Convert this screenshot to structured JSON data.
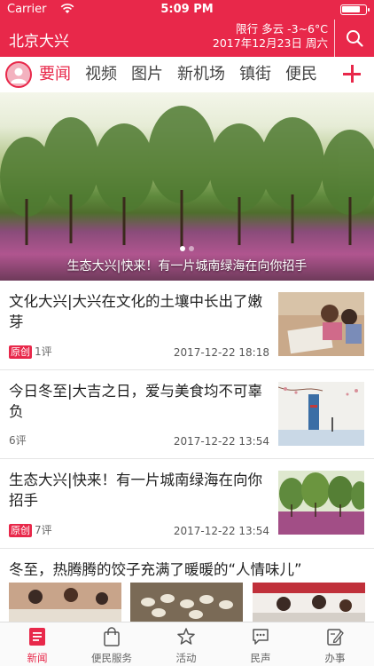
{
  "status_bar": {
    "carrier": "Carrier",
    "time": "5:09 PM",
    "battery_level": 0.85
  },
  "header": {
    "city": "北京大兴",
    "weather_line1": "限行 多云 -3~6°C",
    "weather_line2": "2017年12月23日 周六"
  },
  "tabs": [
    "要闻",
    "视频",
    "图片",
    "新机场",
    "镇街",
    "便民"
  ],
  "active_tab": 0,
  "banner": {
    "caption": "生态大兴|快来！有一片城南绿海在向你招手",
    "page_count": 2,
    "current_page": 1
  },
  "news": [
    {
      "title": "文化大兴|大兴在文化的土壤中长出了嫩芽",
      "tag": "原创",
      "comments": "1评",
      "date": "2017-12-22 18:18",
      "thumb": "children-drawing"
    },
    {
      "title": "今日冬至|大吉之日，爱与美食均不可辜负",
      "tag": "",
      "comments": "6评",
      "date": "2017-12-22 13:54",
      "thumb": "winter-solstice-poster"
    },
    {
      "title": "生态大兴|快来！有一片城南绿海在向你招手",
      "tag": "原创",
      "comments": "7评",
      "date": "2017-12-22 13:54",
      "thumb": "green-forest-flowers"
    }
  ],
  "feature": {
    "title": "冬至，热腾腾的饺子充满了暖暖的“人情味儿”"
  },
  "tabbar": [
    {
      "label": "新闻",
      "icon": "news-icon"
    },
    {
      "label": "便民服务",
      "icon": "bag-icon"
    },
    {
      "label": "活动",
      "icon": "star-icon"
    },
    {
      "label": "民声",
      "icon": "chat-icon"
    },
    {
      "label": "办事",
      "icon": "edit-icon"
    }
  ],
  "active_tabbar": 0,
  "colors": {
    "brand": "#e8284a",
    "text": "#222222",
    "muted": "#666666"
  }
}
